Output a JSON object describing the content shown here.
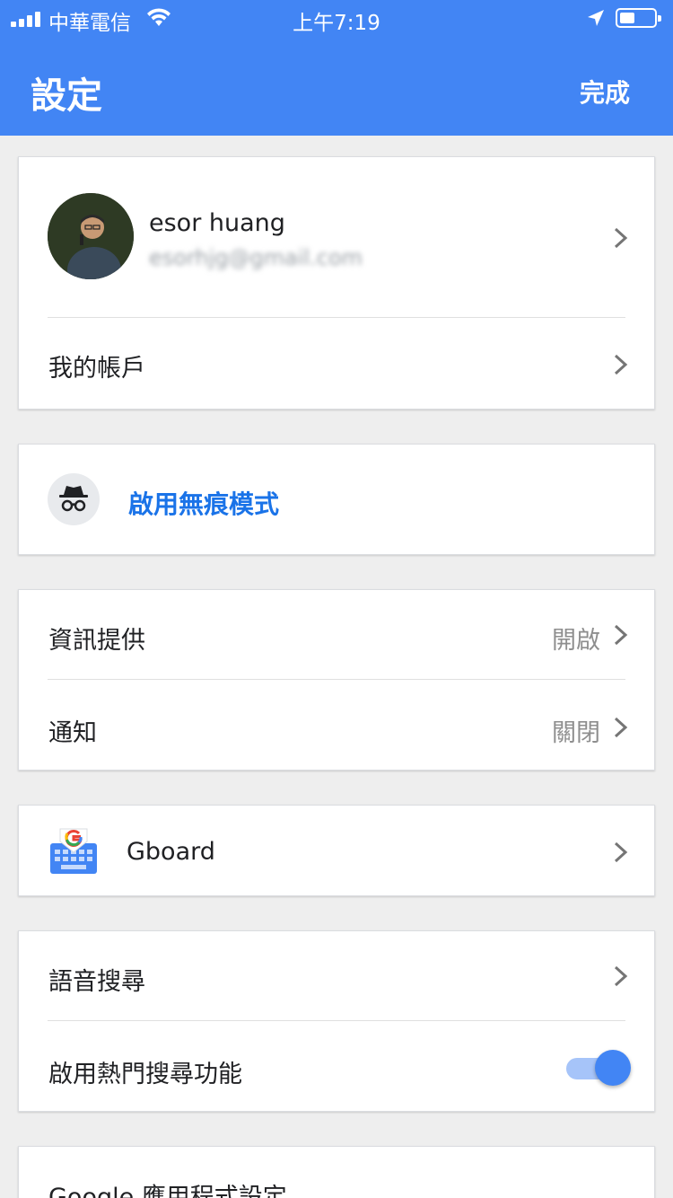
{
  "status_bar": {
    "carrier": "中華電信",
    "time": "上午7:19",
    "battery_level": 0.45
  },
  "header": {
    "title": "設定",
    "done_label": "完成"
  },
  "account": {
    "name": "esor huang",
    "email": "esorhjg@gmail.com",
    "my_account_label": "我的帳戶"
  },
  "incognito": {
    "label": "啟用無痕模式",
    "icon": "incognito-icon"
  },
  "feed": {
    "label": "資訊提供",
    "value": "開啟"
  },
  "notifications": {
    "label": "通知",
    "value": "關閉"
  },
  "gboard": {
    "label": "Gboard",
    "icon": "gboard-icon"
  },
  "voice_search": {
    "label": "語音搜尋"
  },
  "trending": {
    "label": "啟用熱門搜尋功能",
    "enabled": true
  },
  "app_settings": {
    "label": "Google 應用程式設定"
  },
  "colors": {
    "accent": "#4285f4",
    "link": "#1a73e8",
    "background": "#eeeeee"
  }
}
